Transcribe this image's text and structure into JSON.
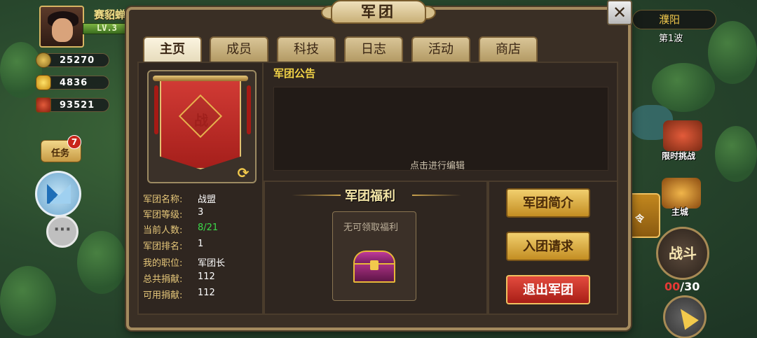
{
  "hud": {
    "player_name": "赛貂蝉",
    "level": "LV.3",
    "copper": "25270",
    "ingot": "4836",
    "token": "93521",
    "quest_label": "任务",
    "quest_badge": "7",
    "chat_icon_text": "···"
  },
  "right_hud": {
    "city": "濮阳",
    "wave": "第1波",
    "event_label": "限时挑战",
    "main_city_label": "主城",
    "side_tab_label": "令",
    "battle_label": "战斗",
    "battle_current": "00",
    "battle_max": "/30"
  },
  "dialog": {
    "title": "军团",
    "close": "✕",
    "tabs": [
      {
        "label": "主页",
        "active": true
      },
      {
        "label": "成员",
        "active": false
      },
      {
        "label": "科技",
        "active": false
      },
      {
        "label": "日志",
        "active": false
      },
      {
        "label": "活动",
        "active": false
      },
      {
        "label": "商店",
        "active": false
      }
    ],
    "banner_char": "战",
    "refresh_icon": "⟳",
    "info": [
      {
        "key": "军团名称:",
        "value": "战盟"
      },
      {
        "key": "军团等级:",
        "value": "3"
      },
      {
        "key": "当前人数:",
        "value": "8/21"
      },
      {
        "key": "军团排名:",
        "value": "1"
      },
      {
        "key": "我的职位:",
        "value": "军团长"
      },
      {
        "key": "总共捐献:",
        "value": "112"
      },
      {
        "key": "可用捐献:",
        "value": "112"
      }
    ],
    "notice_title": "军团公告",
    "notice_hint": "点击进行编辑",
    "welfare_title": "军团福利",
    "welfare_empty": "无可领取福利",
    "buttons": {
      "intro": "军团简介",
      "join_requests": "入团请求",
      "quit": "退出军团"
    }
  },
  "colors": {
    "accent_gold": "#f2c94c",
    "quit_red": "#c9261b",
    "member_count_green": "#3cd94a"
  }
}
